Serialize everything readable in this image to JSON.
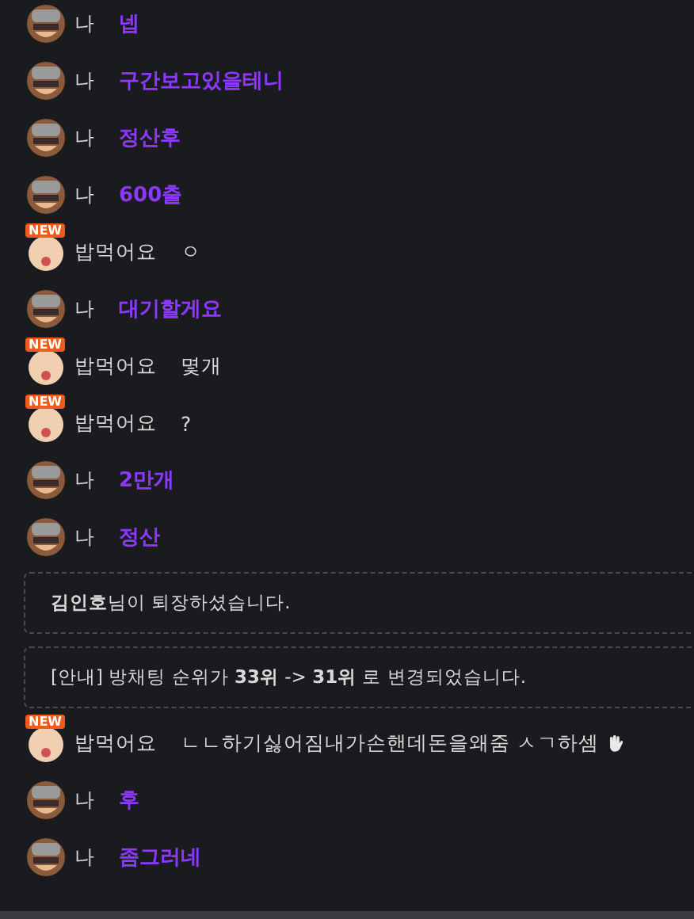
{
  "messages": [
    {
      "kind": "chat",
      "mine": true,
      "nickname": "나",
      "text": "넵"
    },
    {
      "kind": "chat",
      "mine": true,
      "nickname": "나",
      "text": "구간보고있을테니"
    },
    {
      "kind": "chat",
      "mine": true,
      "nickname": "나",
      "text": "정산후"
    },
    {
      "kind": "chat",
      "mine": true,
      "nickname": "나",
      "text": "600출"
    },
    {
      "kind": "chat",
      "mine": false,
      "badge": "NEW",
      "nickname": "밥먹어요",
      "text": "ㅇ"
    },
    {
      "kind": "chat",
      "mine": true,
      "nickname": "나",
      "text": "대기할게요"
    },
    {
      "kind": "chat",
      "mine": false,
      "badge": "NEW",
      "nickname": "밥먹어요",
      "text": "몇개"
    },
    {
      "kind": "chat",
      "mine": false,
      "badge": "NEW",
      "nickname": "밥먹어요",
      "text": "?"
    },
    {
      "kind": "chat",
      "mine": true,
      "nickname": "나",
      "text": "2만개"
    },
    {
      "kind": "chat",
      "mine": true,
      "nickname": "나",
      "text": "정산"
    },
    {
      "kind": "notice",
      "text": "**김인호**님이 퇴장하셨습니다."
    },
    {
      "kind": "notice",
      "text": "[안내] 방채팅 순위가 **33위** -> **31위** 로 변경되었습니다."
    },
    {
      "kind": "chat",
      "mine": false,
      "badge": "NEW",
      "nickname": "밥먹어요",
      "text": "ㄴㄴ하기싫어짐내가손핸데돈을왜줌 ㅅㄱ하셈",
      "wave_icon": true
    },
    {
      "kind": "chat",
      "mine": true,
      "nickname": "나",
      "text": "후"
    },
    {
      "kind": "chat",
      "mine": true,
      "nickname": "나",
      "text": "좀그러네"
    }
  ]
}
